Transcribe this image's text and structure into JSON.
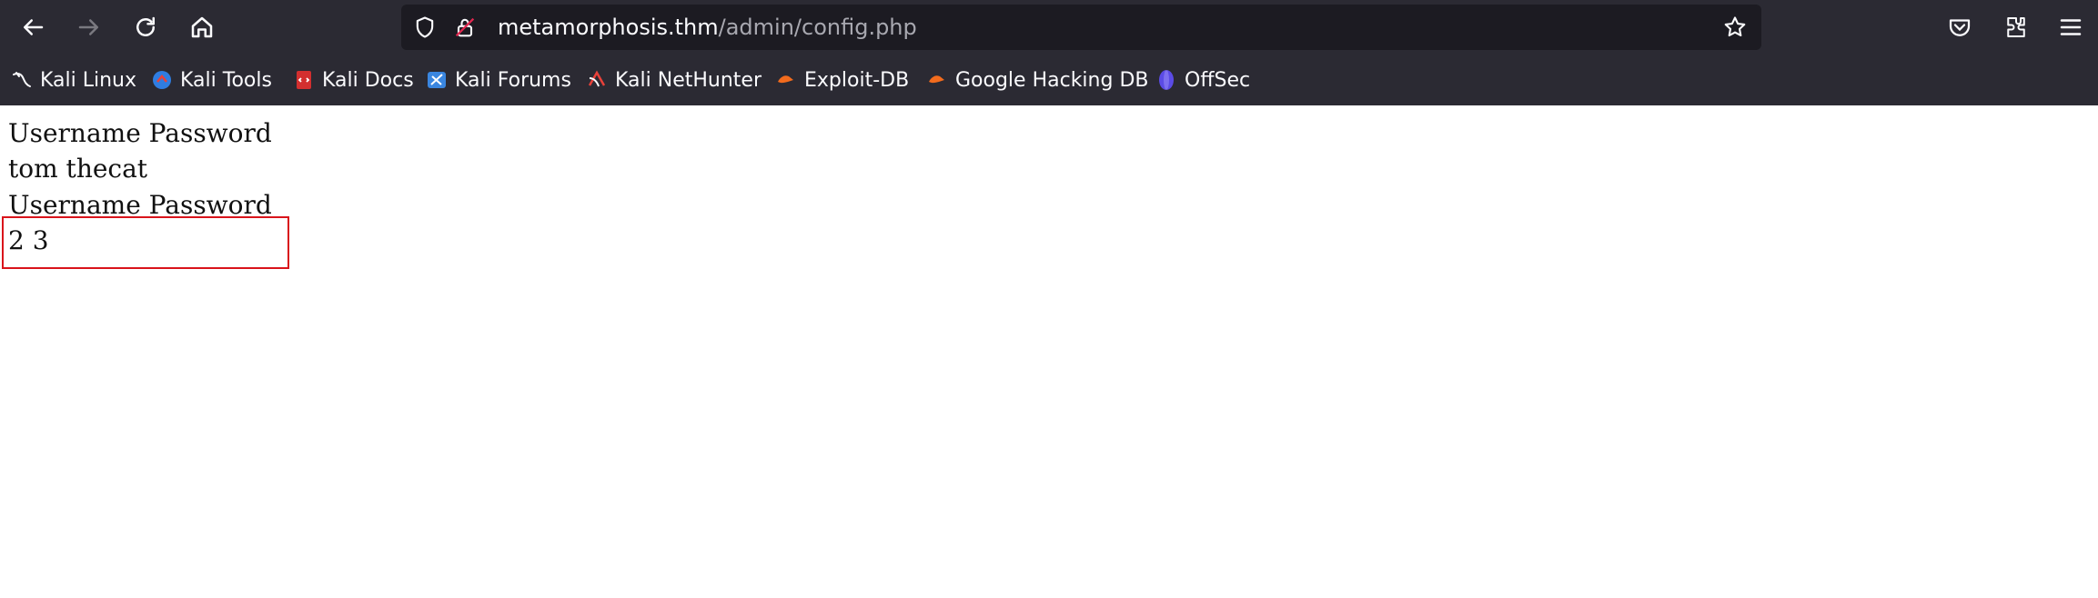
{
  "browser": {
    "url_host": "metamorphosis.thm",
    "url_path": "/admin/config.php",
    "nav": {
      "back_icon": "arrow-left-icon",
      "forward_icon": "arrow-right-icon",
      "reload_icon": "reload-icon",
      "home_icon": "home-icon"
    },
    "right_icons": [
      "pocket-icon",
      "extensions-icon",
      "menu-icon"
    ]
  },
  "bookmarks": [
    {
      "label": "Kali Linux",
      "icon": "kali-dragon-icon"
    },
    {
      "label": "Kali Tools",
      "icon": "kali-tools-icon"
    },
    {
      "label": "Kali Docs",
      "icon": "kali-docs-icon"
    },
    {
      "label": "Kali Forums",
      "icon": "kali-forums-icon"
    },
    {
      "label": "Kali NetHunter",
      "icon": "kali-nethunter-icon"
    },
    {
      "label": "Exploit-DB",
      "icon": "exploit-db-icon"
    },
    {
      "label": "Google Hacking DB",
      "icon": "ghdb-icon"
    },
    {
      "label": "OffSec",
      "icon": "offsec-icon"
    }
  ],
  "page": {
    "lines": [
      "Username Password",
      "tom thecat",
      "Username Password",
      "2 3"
    ]
  },
  "colors": {
    "toolbar_bg": "#2b2a33",
    "urlbar_bg": "#1c1b22",
    "highlight_border": "#d9141b"
  }
}
